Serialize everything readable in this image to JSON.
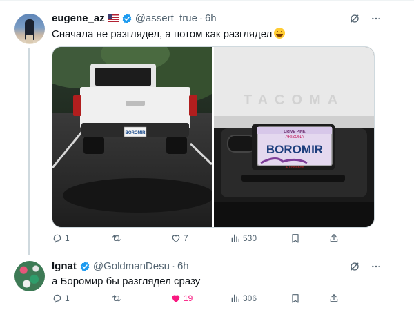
{
  "tweets": [
    {
      "name": "eugene_az",
      "handle": "@assert_true",
      "dot": "·",
      "time": "6h",
      "text": "Сначала не разглядел, а потом как разглядел",
      "photos": [
        {
          "plate": "BOROMIR"
        },
        {
          "tailgate": "TACOMA",
          "plate_top": "DRIVE PINK",
          "plate_state": "ARIZONA",
          "plate": "BOROMIR",
          "dealer": "AutoNation"
        }
      ],
      "actions": {
        "replies": "1",
        "reposts": "",
        "likes": "7",
        "views": "530"
      }
    },
    {
      "name": "Ignat",
      "handle": "@GoldmanDesu",
      "dot": "·",
      "time": "6h",
      "text": "а Боромир бы разглядел сразу",
      "actions": {
        "replies": "1",
        "reposts": "",
        "likes": "19",
        "views": "306"
      }
    }
  ],
  "icons": [
    "grok-icon",
    "more-icon",
    "reply-icon",
    "repost-icon",
    "like-icon",
    "views-icon",
    "bookmark-icon",
    "share-icon",
    "verified-badge-icon"
  ],
  "colors": {
    "verified": "#1d9bf0",
    "liked": "#f91880",
    "muted": "#536471"
  }
}
